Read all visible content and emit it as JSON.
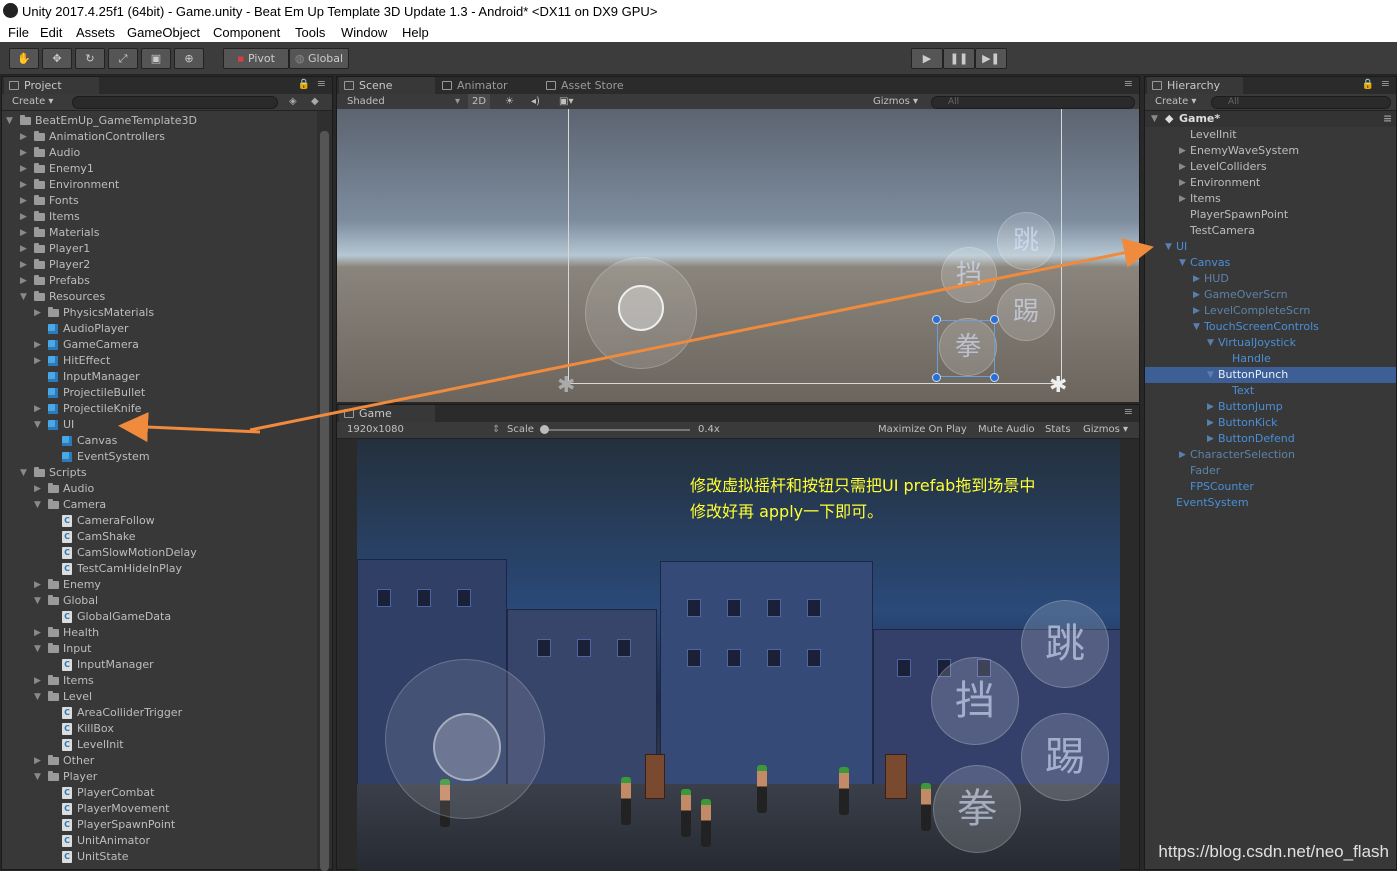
{
  "window": {
    "title": "Unity 2017.4.25f1 (64bit) - Game.unity - Beat Em Up Template 3D Update 1.3 - Android* <DX11 on DX9 GPU>"
  },
  "menu": [
    "File",
    "Edit",
    "Assets",
    "GameObject",
    "Component",
    "Tools",
    "Window",
    "Help"
  ],
  "toolbar": {
    "pivot": "Pivot",
    "global": "Global"
  },
  "project": {
    "tab": "Project",
    "create": "Create",
    "tree": [
      {
        "label": "BeatEmUp_GameTemplate3D",
        "indent": 0,
        "icon": "folder",
        "expanded": true
      },
      {
        "label": "AnimationControllers",
        "indent": 1,
        "icon": "folder"
      },
      {
        "label": "Audio",
        "indent": 1,
        "icon": "folder"
      },
      {
        "label": "Enemy1",
        "indent": 1,
        "icon": "folder"
      },
      {
        "label": "Environment",
        "indent": 1,
        "icon": "folder"
      },
      {
        "label": "Fonts",
        "indent": 1,
        "icon": "folder"
      },
      {
        "label": "Items",
        "indent": 1,
        "icon": "folder"
      },
      {
        "label": "Materials",
        "indent": 1,
        "icon": "folder"
      },
      {
        "label": "Player1",
        "indent": 1,
        "icon": "folder"
      },
      {
        "label": "Player2",
        "indent": 1,
        "icon": "folder"
      },
      {
        "label": "Prefabs",
        "indent": 1,
        "icon": "folder"
      },
      {
        "label": "Resources",
        "indent": 1,
        "icon": "folder",
        "expanded": true
      },
      {
        "label": "PhysicsMaterials",
        "indent": 2,
        "icon": "folder"
      },
      {
        "label": "AudioPlayer",
        "indent": 2,
        "icon": "prefab"
      },
      {
        "label": "GameCamera",
        "indent": 2,
        "icon": "prefab",
        "hasArrow": true
      },
      {
        "label": "HitEffect",
        "indent": 2,
        "icon": "prefab",
        "hasArrow": true
      },
      {
        "label": "InputManager",
        "indent": 2,
        "icon": "prefab"
      },
      {
        "label": "ProjectileBullet",
        "indent": 2,
        "icon": "prefab"
      },
      {
        "label": "ProjectileKnife",
        "indent": 2,
        "icon": "prefab",
        "hasArrow": true
      },
      {
        "label": "UI",
        "indent": 2,
        "icon": "prefab",
        "expanded": true
      },
      {
        "label": "Canvas",
        "indent": 3,
        "icon": "prefab"
      },
      {
        "label": "EventSystem",
        "indent": 3,
        "icon": "prefab"
      },
      {
        "label": "Scripts",
        "indent": 1,
        "icon": "folder",
        "expanded": true
      },
      {
        "label": "Audio",
        "indent": 2,
        "icon": "folder"
      },
      {
        "label": "Camera",
        "indent": 2,
        "icon": "folder",
        "expanded": true
      },
      {
        "label": "CameraFollow",
        "indent": 3,
        "icon": "script"
      },
      {
        "label": "CamShake",
        "indent": 3,
        "icon": "script"
      },
      {
        "label": "CamSlowMotionDelay",
        "indent": 3,
        "icon": "script"
      },
      {
        "label": "TestCamHideInPlay",
        "indent": 3,
        "icon": "script"
      },
      {
        "label": "Enemy",
        "indent": 2,
        "icon": "folder"
      },
      {
        "label": "Global",
        "indent": 2,
        "icon": "folder",
        "expanded": true
      },
      {
        "label": "GlobalGameData",
        "indent": 3,
        "icon": "script"
      },
      {
        "label": "Health",
        "indent": 2,
        "icon": "folder"
      },
      {
        "label": "Input",
        "indent": 2,
        "icon": "folder",
        "expanded": true
      },
      {
        "label": "InputManager",
        "indent": 3,
        "icon": "script"
      },
      {
        "label": "Items",
        "indent": 2,
        "icon": "folder"
      },
      {
        "label": "Level",
        "indent": 2,
        "icon": "folder",
        "expanded": true
      },
      {
        "label": "AreaColliderTrigger",
        "indent": 3,
        "icon": "script"
      },
      {
        "label": "KillBox",
        "indent": 3,
        "icon": "script"
      },
      {
        "label": "LevelInit",
        "indent": 3,
        "icon": "script"
      },
      {
        "label": "Other",
        "indent": 2,
        "icon": "folder"
      },
      {
        "label": "Player",
        "indent": 2,
        "icon": "folder",
        "expanded": true
      },
      {
        "label": "PlayerCombat",
        "indent": 3,
        "icon": "script"
      },
      {
        "label": "PlayerMovement",
        "indent": 3,
        "icon": "script"
      },
      {
        "label": "PlayerSpawnPoint",
        "indent": 3,
        "icon": "script"
      },
      {
        "label": "UnitAnimator",
        "indent": 3,
        "icon": "script"
      },
      {
        "label": "UnitState",
        "indent": 3,
        "icon": "script"
      }
    ]
  },
  "scene": {
    "tabs": [
      "Scene",
      "Animator",
      "Asset Store"
    ],
    "shading": "Shaded",
    "mode2d": "2D",
    "gizmos": "Gizmos",
    "search": "All",
    "buttons": {
      "jump": "跳",
      "block": "挡",
      "kick": "踢",
      "punch": "拳"
    }
  },
  "game": {
    "tab": "Game",
    "resolution": "1920x1080",
    "scale_label": "Scale",
    "scale_value": "0.4x",
    "maximize": "Maximize On Play",
    "mute": "Mute Audio",
    "stats": "Stats",
    "gizmos": "Gizmos",
    "buttons": {
      "jump": "跳",
      "block": "挡",
      "kick": "踢",
      "punch": "拳"
    }
  },
  "hierarchy": {
    "tab": "Hierarchy",
    "create": "Create",
    "search": "All",
    "scene_name": "Game*",
    "items": [
      {
        "label": "LevelInit",
        "indent": 1,
        "style": "normal"
      },
      {
        "label": "EnemyWaveSystem",
        "indent": 1,
        "style": "normal",
        "hasArrow": true
      },
      {
        "label": "LevelColliders",
        "indent": 1,
        "style": "normal",
        "hasArrow": true
      },
      {
        "label": "Environment",
        "indent": 1,
        "style": "normal",
        "hasArrow": true
      },
      {
        "label": "Items",
        "indent": 1,
        "style": "normal",
        "hasArrow": true
      },
      {
        "label": "PlayerSpawnPoint",
        "indent": 1,
        "style": "normal"
      },
      {
        "label": "TestCamera",
        "indent": 1,
        "style": "normal"
      },
      {
        "label": "UI",
        "indent": 0,
        "style": "blue",
        "expanded": true
      },
      {
        "label": "Canvas",
        "indent": 1,
        "style": "blue",
        "expanded": true
      },
      {
        "label": "HUD",
        "indent": 2,
        "style": "dim",
        "hasArrow": true
      },
      {
        "label": "GameOverScrn",
        "indent": 2,
        "style": "dim",
        "hasArrow": true
      },
      {
        "label": "LevelCompleteScrn",
        "indent": 2,
        "style": "dim",
        "hasArrow": true
      },
      {
        "label": "TouchScreenControls",
        "indent": 2,
        "style": "blue",
        "expanded": true
      },
      {
        "label": "VirtualJoystick",
        "indent": 3,
        "style": "blue",
        "expanded": true
      },
      {
        "label": "Handle",
        "indent": 4,
        "style": "blue"
      },
      {
        "label": "ButtonPunch",
        "indent": 3,
        "style": "blue",
        "expanded": true,
        "selected": true
      },
      {
        "label": "Text",
        "indent": 4,
        "style": "blue"
      },
      {
        "label": "ButtonJump",
        "indent": 3,
        "style": "blue",
        "hasArrow": true
      },
      {
        "label": "ButtonKick",
        "indent": 3,
        "style": "blue",
        "hasArrow": true
      },
      {
        "label": "ButtonDefend",
        "indent": 3,
        "style": "blue",
        "hasArrow": true
      },
      {
        "label": "CharacterSelection",
        "indent": 1,
        "style": "dim",
        "hasArrow": true
      },
      {
        "label": "Fader",
        "indent": 1,
        "style": "dim"
      },
      {
        "label": "FPSCounter",
        "indent": 1,
        "style": "blue"
      },
      {
        "label": "EventSystem",
        "indent": 0,
        "style": "blue"
      }
    ]
  },
  "annotation": {
    "line1": "修改虚拟摇杆和按钮只需把UI prefab拖到场景中",
    "line2": "修改好再 apply一下即可。"
  },
  "watermark": "https://blog.csdn.net/neo_flash",
  "colors": {
    "accent": "#f08a3c",
    "selection": "#3e5f96",
    "prefab_blue": "#4a8fd6",
    "annotation": "#ffff33"
  }
}
